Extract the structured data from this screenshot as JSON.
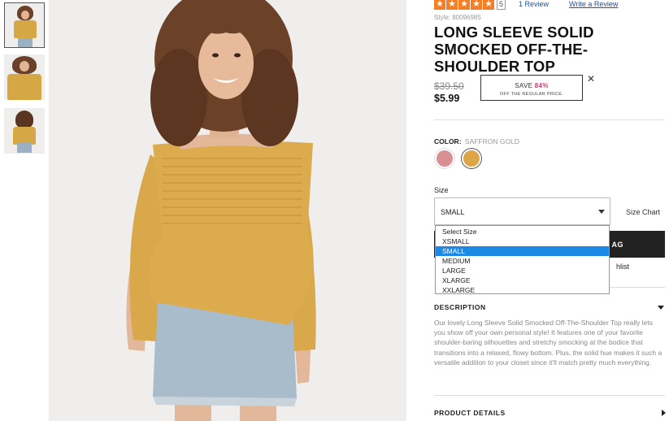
{
  "rating": {
    "stars": 5,
    "count_badge": "5",
    "review_link": "1 Review",
    "write_review": "Write a Review"
  },
  "product": {
    "style_number": "Style: 80096985",
    "title": "LONG SLEEVE SOLID SMOCKED OFF-THE-SHOULDER TOP",
    "old_price": "$39.50",
    "price": "$5.99"
  },
  "promo": {
    "save_prefix": "SAVE",
    "save_pct": "84%",
    "subtext": "OFF THE REGULAR PRICE.",
    "close": "✕"
  },
  "color": {
    "label": "COLOR:",
    "selected_name": "SAFFRON GOLD",
    "swatches": [
      {
        "name": "pink",
        "hex": "#d98f8f"
      },
      {
        "name": "saffron-gold",
        "hex": "#dba548"
      }
    ]
  },
  "size": {
    "label": "Size",
    "selected": "SMALL",
    "size_chart": "Size Chart",
    "options": [
      "Select Size",
      "XSMALL",
      "SMALL",
      "MEDIUM",
      "LARGE",
      "XLARGE",
      "XXLARGE"
    ],
    "selected_index": 2
  },
  "actions": {
    "bag_label_partial": "AG",
    "wishlist_partial": "hlist"
  },
  "description": {
    "heading": "DESCRIPTION",
    "text": "Our lovely Long Sleeve Solid Smocked Off-The-Shoulder Top really lets you show off your own personal style! It features one of your favorite shoulder-baring silhouettes and stretchy smocking at the bodice that transitions into a relaxed, flowy bottom. Plus, the solid hue makes it such a versatile addition to your closet since it'll match pretty much everything."
  },
  "product_details": {
    "heading": "PRODUCT DETAILS"
  },
  "colors": {
    "accent_star": "#f47d25",
    "link": "#1f4fa0",
    "save_pct": "#d6316f",
    "select_highlight": "#1e88e5"
  }
}
